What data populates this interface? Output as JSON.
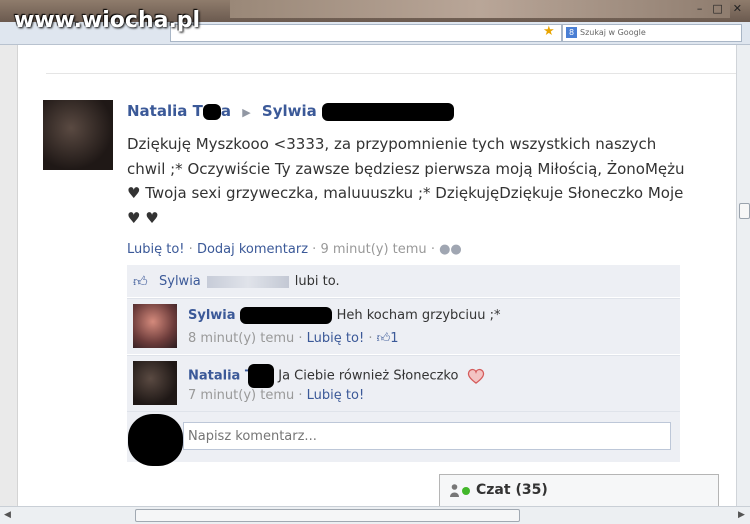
{
  "watermark": "www.wiocha.pl",
  "browser": {
    "search_placeholder": "Szukaj w Google",
    "search_engine_badge": "8",
    "star_icon": "star-icon"
  },
  "post": {
    "author_first": "Natalia",
    "author_last_visible": "T",
    "author_last_tail": "a",
    "arrow": "▶",
    "target_first": "Sylwia",
    "body": "Dziękuję Myszkooo <3333, za przypomnienie tych wszystkich naszych chwil ;* Oczywiście Ty zawsze będziesz pierwsza moją Miłością, ŻonoMężu ♥ Twoja sexi grzyweczka, maluuuszku ;* DziękujęDziękuje Słoneczko Moje ♥ ♥",
    "like_link": "Lubię to!",
    "comment_link": "Dodaj komentarz",
    "sep": "·",
    "time": "9 minut(y) temu"
  },
  "likes": {
    "name": "Sylwia",
    "suffix": "lubi to."
  },
  "comments": [
    {
      "name": "Sylwia",
      "text": "Heh kocham grzybciuu ;*",
      "time": "8 minut(y) temu",
      "like": "Lubię to!",
      "like_count": "1"
    },
    {
      "name": "Natalia T",
      "text": "Ja Ciebie również Słoneczko",
      "time": "7 minut(y) temu",
      "like": "Lubię to!"
    }
  ],
  "comment_input": {
    "placeholder": "Napisz komentarz..."
  },
  "chat": {
    "label": "Czat",
    "count": "(35)"
  },
  "colors": {
    "link": "#3b5998",
    "meta": "#999999",
    "panel": "#edeff4",
    "online": "#42b72a"
  }
}
